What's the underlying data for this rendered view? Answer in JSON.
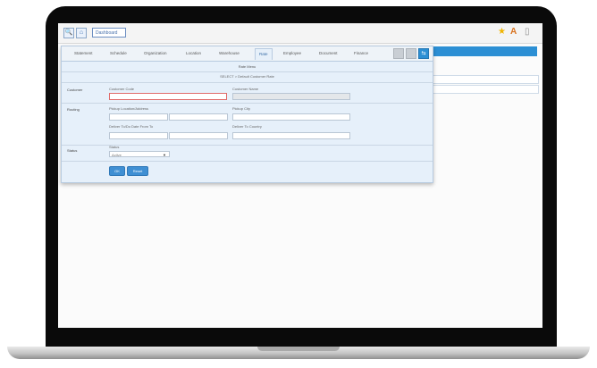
{
  "toolbar": {
    "search_icon": "🔍",
    "home_icon": "⌂",
    "dashboard_tab": "Dashboard",
    "star_icon": "★",
    "font_icon": "A",
    "doc_icon": "▯"
  },
  "dialog": {
    "tabs": [
      "Statement",
      "Schedule",
      "Organization",
      "Location",
      "Warehouse",
      "Rate",
      "Employee",
      "Document",
      "Finance"
    ],
    "active_tab": "Rate",
    "window_buttons": {
      "minimize": "",
      "maximize": "",
      "close": "⇆"
    },
    "title": "Rate Menu",
    "breadcrumb": "SELECT > Default Customer Rate",
    "sections": {
      "customer": "Customer",
      "routing": "Routing",
      "status": "Status"
    },
    "fields": {
      "customer_code_label": "Customer Code",
      "customer_name_label": "Customer Name",
      "pickup_label": "Pickup Location/Address",
      "pickup_city_label": "Pickup City",
      "deliver_date_label": "Deliver To/Do Date From To",
      "deliver_country_label": "Deliver To Country",
      "status_label": "Status",
      "status_value": "Active"
    },
    "buttons": {
      "ok": "OK",
      "reset": "Reset"
    }
  }
}
